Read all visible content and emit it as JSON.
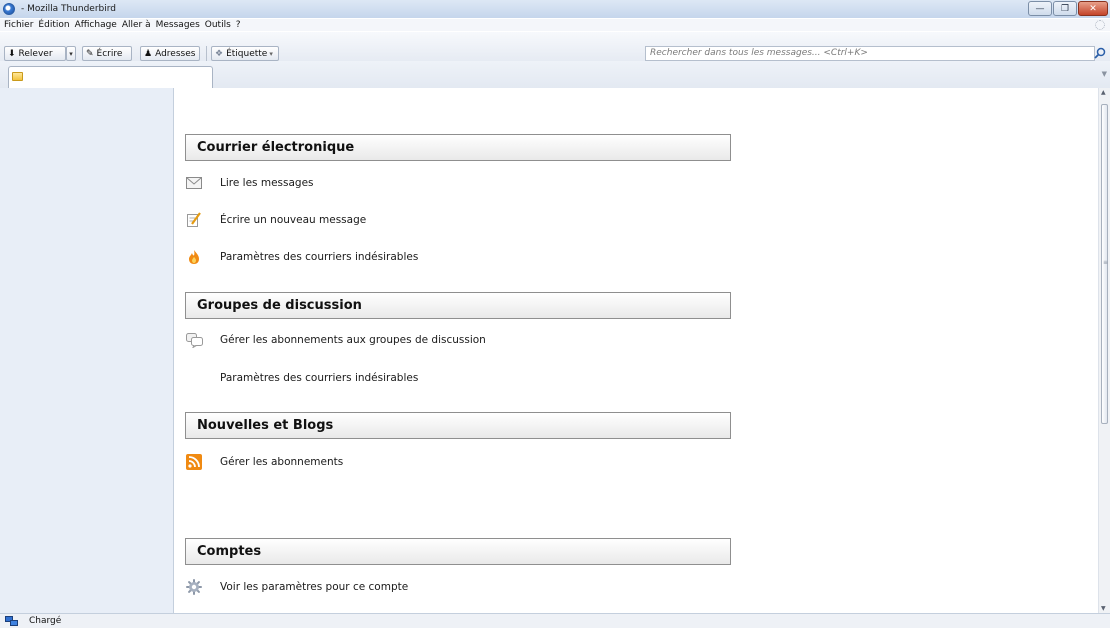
{
  "window": {
    "title": " - Mozilla Thunderbird"
  },
  "menubar": {
    "items": [
      "Fichier",
      "Édition",
      "Affichage",
      "Aller à",
      "Messages",
      "Outils",
      "?"
    ]
  },
  "toolbar": {
    "get_mail_label": "Relever",
    "write_label": "Écrire",
    "address_book_label": "Adresses",
    "tag_label": "Étiquette"
  },
  "search": {
    "placeholder": "Rechercher dans tous les messages... <Ctrl+K>"
  },
  "sections": {
    "email": {
      "title": "Courrier électronique",
      "read_messages": "Lire les messages",
      "write_message": "Écrire un nouveau message",
      "junk_settings": "Paramètres des courriers indésirables"
    },
    "newsgroups": {
      "title": "Groupes de discussion",
      "manage_subscriptions": "Gérer les abonnements aux groupes de discussion",
      "junk_settings": "Paramètres des courriers indésirables"
    },
    "feeds": {
      "title": "Nouvelles et Blogs",
      "manage_subscriptions": "Gérer les abonnements"
    },
    "accounts": {
      "title": "Comptes",
      "view_settings": "Voir les paramètres pour ce compte"
    }
  },
  "status": {
    "text": "Chargé"
  },
  "colors": {
    "titlebar": "#c5d6ec",
    "folder_pane": "#e8eef7",
    "close_button": "#c4442a",
    "section_border": "#8f8f8f"
  }
}
